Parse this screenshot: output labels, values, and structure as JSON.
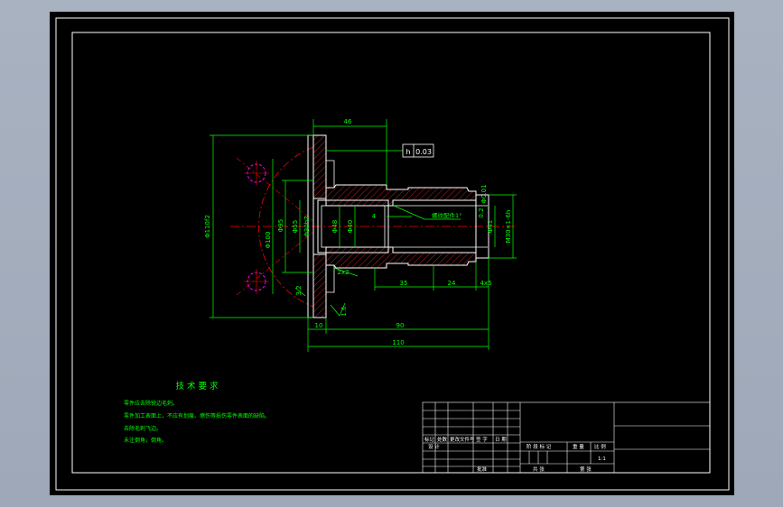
{
  "colors": {
    "canvas": "#000000",
    "frame": "#ffffff",
    "outline": "#ffffff",
    "dimension": "#00ff00",
    "centerline": "#ff0000",
    "hatch": "#ff3333",
    "hole": "#ff00ff",
    "text": "#00ff00",
    "tag": "#ffffff",
    "titleblock": "#ffffff"
  },
  "dimensions": {
    "flange_width": "46",
    "length_90": "90",
    "length_110": "110",
    "dim_10": "10",
    "dim_35": "35",
    "dim_24": "24",
    "dim_4x5": "4x5",
    "dim_4": "4",
    "chamfer": "2x2",
    "phi_150": "Φ110f2",
    "phi_100": "Φ100",
    "phi_95": "Φ95",
    "phi_55": "Φ55",
    "phi_48": "Φ48",
    "phi_40": "Φ40",
    "phi_41": "Φ41",
    "phi_30": "Φ30h7",
    "thread": "M30×1-6h",
    "runout": "Φ0.01",
    "surface_16": "1.6",
    "surface_32": "3.2",
    "chamfer_r": "0.2",
    "callout_thread": "螺纹配件1°"
  },
  "tolerance_frame": {
    "symbol": "h",
    "value": "0.03"
  },
  "notes": {
    "heading": "技 术 要 求",
    "items": [
      "零件应去除锐边毛刺。",
      "零件加工表面上，不应有划痕、擦伤等损伤零件表面的缺陷。",
      "去除毛刺飞边。",
      "未注倒角，倒角。"
    ]
  },
  "title_block": {
    "labels": {
      "revision": "标记",
      "count": "处数",
      "doc_no": "更改文件号",
      "signature": "签 字",
      "date": "日 期",
      "designer": "设 计",
      "stage": "阶 段 标 记",
      "weight": "重 量",
      "scale_label": "比 例",
      "scale": "1:1",
      "approve": "批准",
      "sheet_total": "共  张",
      "sheet_no": "第  张"
    }
  }
}
